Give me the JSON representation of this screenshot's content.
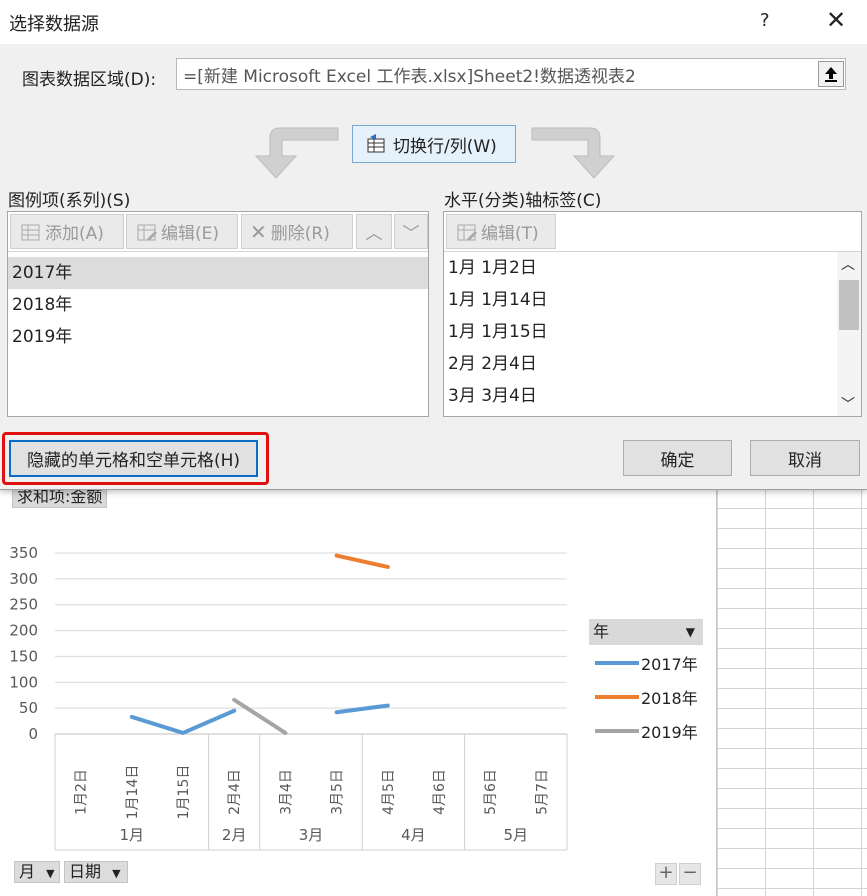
{
  "dialog": {
    "title": "选择数据源",
    "help": "?",
    "close": "✕",
    "range_label": "图表数据区域(D):",
    "range_value": "=[新建 Microsoft Excel 工作表.xlsx]Sheet2!数据透视表2",
    "switch_label": "切换行/列(W)",
    "series_panel": {
      "label": "图例项(系列)(S)",
      "add": "添加(A)",
      "edit": "编辑(E)",
      "remove": "删除(R)",
      "items": [
        "2017年",
        "2018年",
        "2019年"
      ]
    },
    "axis_panel": {
      "label": "水平(分类)轴标签(C)",
      "edit": "编辑(T)",
      "items": [
        "1月 1月2日",
        "1月 1月14日",
        "1月 1月15日",
        "2月 2月4日",
        "3月 3月4日"
      ]
    },
    "hidden_cells_button": "隐藏的单元格和空单元格(H)",
    "ok": "确定",
    "cancel": "取消"
  },
  "chart": {
    "value_field": "求和项:金额",
    "legend_field": "年",
    "row_fields": [
      "月",
      "日期"
    ],
    "zoom_in": "+",
    "zoom_out": "−"
  },
  "chart_data": {
    "type": "line",
    "x_ticks": [
      "1月2日",
      "1月14日",
      "1月15日",
      "2月4日",
      "3月4日",
      "3月5日",
      "4月5日",
      "4月6日",
      "5月6日",
      "5月7日"
    ],
    "x_groups": [
      {
        "label": "1月",
        "span": 3
      },
      {
        "label": "2月",
        "span": 1
      },
      {
        "label": "3月",
        "span": 2
      },
      {
        "label": "4月",
        "span": 2
      },
      {
        "label": "5月",
        "span": 2
      }
    ],
    "y_ticks": [
      0,
      50,
      100,
      150,
      200,
      250,
      300,
      350
    ],
    "ylim": [
      0,
      350
    ],
    "series": [
      {
        "name": "2017年",
        "color": "#5b9bd5",
        "values": [
          null,
          33,
          2,
          45,
          null,
          42,
          55,
          null,
          null,
          null
        ]
      },
      {
        "name": "2018年",
        "color": "#ed7d31",
        "values": [
          null,
          null,
          null,
          null,
          null,
          345,
          323,
          null,
          null,
          null
        ]
      },
      {
        "name": "2019年",
        "color": "#a5a5a5",
        "values": [
          null,
          null,
          null,
          66,
          2,
          null,
          null,
          null,
          null,
          null
        ]
      }
    ]
  }
}
